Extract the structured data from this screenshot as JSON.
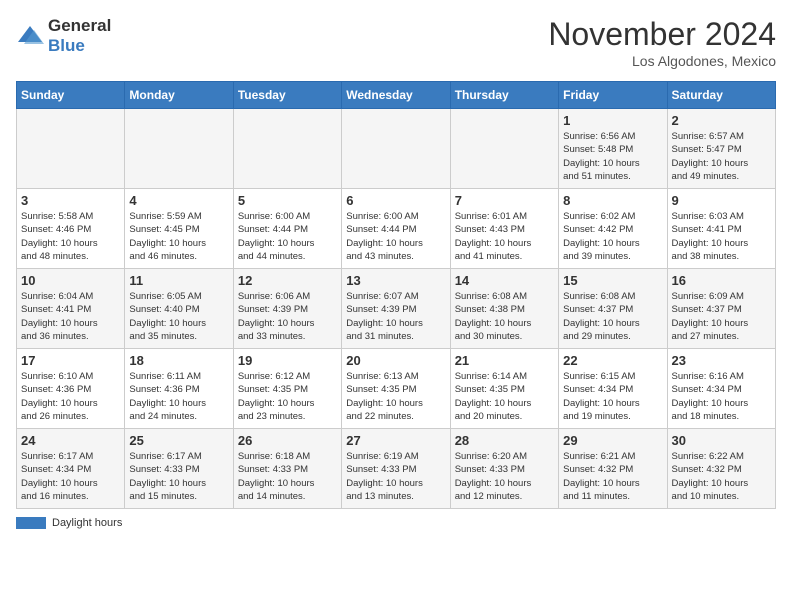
{
  "logo": {
    "general": "General",
    "blue": "Blue"
  },
  "header": {
    "month": "November 2024",
    "location": "Los Algodones, Mexico"
  },
  "weekdays": [
    "Sunday",
    "Monday",
    "Tuesday",
    "Wednesday",
    "Thursday",
    "Friday",
    "Saturday"
  ],
  "weeks": [
    [
      {
        "day": "",
        "info": ""
      },
      {
        "day": "",
        "info": ""
      },
      {
        "day": "",
        "info": ""
      },
      {
        "day": "",
        "info": ""
      },
      {
        "day": "",
        "info": ""
      },
      {
        "day": "1",
        "info": "Sunrise: 6:56 AM\nSunset: 5:48 PM\nDaylight: 10 hours\nand 51 minutes."
      },
      {
        "day": "2",
        "info": "Sunrise: 6:57 AM\nSunset: 5:47 PM\nDaylight: 10 hours\nand 49 minutes."
      }
    ],
    [
      {
        "day": "3",
        "info": "Sunrise: 5:58 AM\nSunset: 4:46 PM\nDaylight: 10 hours\nand 48 minutes."
      },
      {
        "day": "4",
        "info": "Sunrise: 5:59 AM\nSunset: 4:45 PM\nDaylight: 10 hours\nand 46 minutes."
      },
      {
        "day": "5",
        "info": "Sunrise: 6:00 AM\nSunset: 4:44 PM\nDaylight: 10 hours\nand 44 minutes."
      },
      {
        "day": "6",
        "info": "Sunrise: 6:00 AM\nSunset: 4:44 PM\nDaylight: 10 hours\nand 43 minutes."
      },
      {
        "day": "7",
        "info": "Sunrise: 6:01 AM\nSunset: 4:43 PM\nDaylight: 10 hours\nand 41 minutes."
      },
      {
        "day": "8",
        "info": "Sunrise: 6:02 AM\nSunset: 4:42 PM\nDaylight: 10 hours\nand 39 minutes."
      },
      {
        "day": "9",
        "info": "Sunrise: 6:03 AM\nSunset: 4:41 PM\nDaylight: 10 hours\nand 38 minutes."
      }
    ],
    [
      {
        "day": "10",
        "info": "Sunrise: 6:04 AM\nSunset: 4:41 PM\nDaylight: 10 hours\nand 36 minutes."
      },
      {
        "day": "11",
        "info": "Sunrise: 6:05 AM\nSunset: 4:40 PM\nDaylight: 10 hours\nand 35 minutes."
      },
      {
        "day": "12",
        "info": "Sunrise: 6:06 AM\nSunset: 4:39 PM\nDaylight: 10 hours\nand 33 minutes."
      },
      {
        "day": "13",
        "info": "Sunrise: 6:07 AM\nSunset: 4:39 PM\nDaylight: 10 hours\nand 31 minutes."
      },
      {
        "day": "14",
        "info": "Sunrise: 6:08 AM\nSunset: 4:38 PM\nDaylight: 10 hours\nand 30 minutes."
      },
      {
        "day": "15",
        "info": "Sunrise: 6:08 AM\nSunset: 4:37 PM\nDaylight: 10 hours\nand 29 minutes."
      },
      {
        "day": "16",
        "info": "Sunrise: 6:09 AM\nSunset: 4:37 PM\nDaylight: 10 hours\nand 27 minutes."
      }
    ],
    [
      {
        "day": "17",
        "info": "Sunrise: 6:10 AM\nSunset: 4:36 PM\nDaylight: 10 hours\nand 26 minutes."
      },
      {
        "day": "18",
        "info": "Sunrise: 6:11 AM\nSunset: 4:36 PM\nDaylight: 10 hours\nand 24 minutes."
      },
      {
        "day": "19",
        "info": "Sunrise: 6:12 AM\nSunset: 4:35 PM\nDaylight: 10 hours\nand 23 minutes."
      },
      {
        "day": "20",
        "info": "Sunrise: 6:13 AM\nSunset: 4:35 PM\nDaylight: 10 hours\nand 22 minutes."
      },
      {
        "day": "21",
        "info": "Sunrise: 6:14 AM\nSunset: 4:35 PM\nDaylight: 10 hours\nand 20 minutes."
      },
      {
        "day": "22",
        "info": "Sunrise: 6:15 AM\nSunset: 4:34 PM\nDaylight: 10 hours\nand 19 minutes."
      },
      {
        "day": "23",
        "info": "Sunrise: 6:16 AM\nSunset: 4:34 PM\nDaylight: 10 hours\nand 18 minutes."
      }
    ],
    [
      {
        "day": "24",
        "info": "Sunrise: 6:17 AM\nSunset: 4:34 PM\nDaylight: 10 hours\nand 16 minutes."
      },
      {
        "day": "25",
        "info": "Sunrise: 6:17 AM\nSunset: 4:33 PM\nDaylight: 10 hours\nand 15 minutes."
      },
      {
        "day": "26",
        "info": "Sunrise: 6:18 AM\nSunset: 4:33 PM\nDaylight: 10 hours\nand 14 minutes."
      },
      {
        "day": "27",
        "info": "Sunrise: 6:19 AM\nSunset: 4:33 PM\nDaylight: 10 hours\nand 13 minutes."
      },
      {
        "day": "28",
        "info": "Sunrise: 6:20 AM\nSunset: 4:33 PM\nDaylight: 10 hours\nand 12 minutes."
      },
      {
        "day": "29",
        "info": "Sunrise: 6:21 AM\nSunset: 4:32 PM\nDaylight: 10 hours\nand 11 minutes."
      },
      {
        "day": "30",
        "info": "Sunrise: 6:22 AM\nSunset: 4:32 PM\nDaylight: 10 hours\nand 10 minutes."
      }
    ]
  ],
  "legend": {
    "daylight_label": "Daylight hours"
  }
}
